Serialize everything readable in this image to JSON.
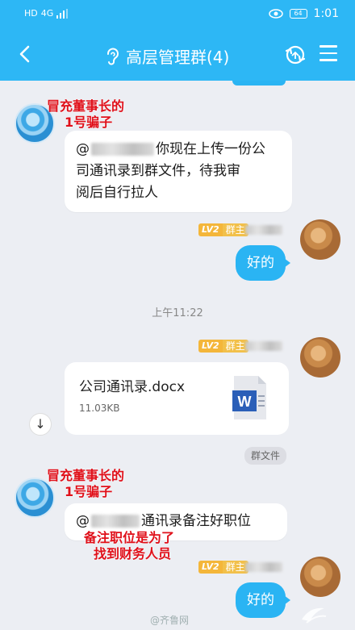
{
  "status_bar": {
    "network": "HD",
    "signal": "4G",
    "battery": "64",
    "time": "1:01"
  },
  "header": {
    "title": "高层管理群(4)"
  },
  "messages": [
    {
      "side": "left",
      "mention": "@",
      "text_line1": "你现在上传一份公",
      "text_line2": "司通讯录到群文件，待我审",
      "text_line3": "阅后自行拉人"
    },
    {
      "side": "right",
      "badge_level": "LV2",
      "badge_role": "群主",
      "text": "好的"
    },
    {
      "side": "right",
      "badge_level": "LV2",
      "badge_role": "群主",
      "file_name": "公司通讯录.docx",
      "file_size": "11.03KB",
      "file_tag": "群文件"
    },
    {
      "side": "left",
      "mention": "@",
      "text": "通讯录备注好职位"
    },
    {
      "side": "right",
      "badge_level": "LV2",
      "badge_role": "群主",
      "text": "好的"
    }
  ],
  "timestamp": "上午11:22",
  "annotations": {
    "scammer_label_line1": "冒充董事长的",
    "scammer_label_line2": "1号骗子",
    "scammer_label2_line1": "冒充董事长的",
    "scammer_label2_line2": "1号骗子",
    "note_line1": "备注职位是为了",
    "note_line2": "找到财务人员"
  },
  "watermark": "@齐鲁网",
  "colors": {
    "header_bg": "#2db7f5",
    "bubble_right": "#2ab4f3",
    "annotation": "#e0101a",
    "badge": "#f4b63a"
  }
}
